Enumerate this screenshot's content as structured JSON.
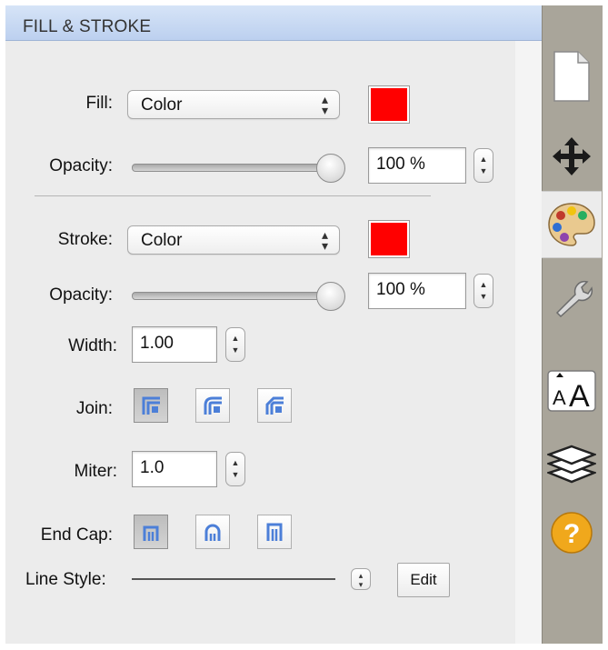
{
  "panel": {
    "title": "FILL & STROKE"
  },
  "fill": {
    "label": "Fill:",
    "type_value": "Color",
    "color": "#ff0000",
    "opacity_label": "Opacity:",
    "opacity_value": "100 %",
    "opacity_level": 1.0
  },
  "stroke": {
    "label": "Stroke:",
    "type_value": "Color",
    "color": "#ff0000",
    "opacity_label": "Opacity:",
    "opacity_value": "100 %",
    "opacity_level": 1.0,
    "width_label": "Width:",
    "width_value": "1.00",
    "join_label": "Join:",
    "join_options": [
      "miter-join-icon",
      "round-join-icon",
      "bevel-join-icon"
    ],
    "join_selected": 0,
    "miter_label": "Miter:",
    "miter_value": "1.0",
    "endcap_label": "End Cap:",
    "endcap_options": [
      "butt-cap-icon",
      "round-cap-icon",
      "square-cap-icon"
    ],
    "endcap_selected": 0,
    "linestyle_label": "Line Style:",
    "edit_label": "Edit"
  },
  "toolbar": {
    "tools": [
      "document-icon",
      "move-icon",
      "palette-icon",
      "wrench-icon",
      "text-size-icon",
      "layers-icon",
      "help-icon"
    ],
    "selected": "palette-icon"
  }
}
